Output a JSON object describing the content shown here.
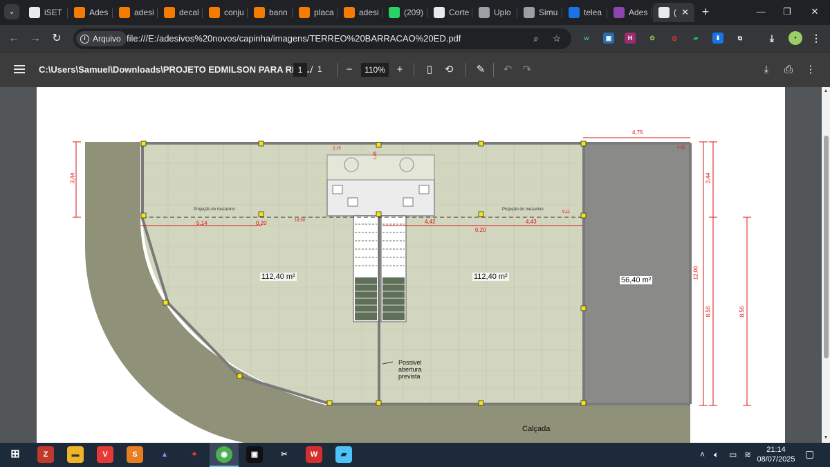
{
  "browser": {
    "tabs": [
      {
        "label": "iSET",
        "icon": "globe-icon",
        "color": "#e8eaed"
      },
      {
        "label": "Ades",
        "icon": "site-icon",
        "color": "#f57c00"
      },
      {
        "label": "adesi",
        "icon": "site-icon",
        "color": "#f57c00"
      },
      {
        "label": "decal",
        "icon": "site-icon",
        "color": "#f57c00"
      },
      {
        "label": "conju",
        "icon": "site-icon",
        "color": "#f57c00"
      },
      {
        "label": "bann",
        "icon": "site-icon",
        "color": "#f57c00"
      },
      {
        "label": "placa",
        "icon": "site-icon",
        "color": "#f57c00"
      },
      {
        "label": "adesi",
        "icon": "site-icon",
        "color": "#f57c00"
      },
      {
        "label": "(209)",
        "icon": "whatsapp-icon",
        "color": "#25d366"
      },
      {
        "label": "Corte",
        "icon": "chatgpt-icon",
        "color": "#e8eaed"
      },
      {
        "label": "Uplo",
        "icon": "globe-icon",
        "color": "#9aa0a6"
      },
      {
        "label": "Simu",
        "icon": "globe-icon",
        "color": "#9aa0a6"
      },
      {
        "label": "telea",
        "icon": "site-icon",
        "color": "#1a73e8"
      },
      {
        "label": "Ades",
        "icon": "site-icon",
        "color": "#8e44ad"
      },
      {
        "label": "(",
        "icon": "globe-icon",
        "color": "#e8eaed"
      }
    ],
    "omnibox": {
      "chip_label": "Arquivo",
      "url": "file:///E:/adesivos%20novos/capinha/imagens/TERREO%20BARRACAO%20ED.pdf"
    }
  },
  "pdf_viewer": {
    "title": "C:\\Users\\Samuel\\Downloads\\PROJETO EDMILSON PARA REN...",
    "page_current": "1",
    "page_separator": "/",
    "page_total": "1",
    "zoom": "110%"
  },
  "plan": {
    "areas": [
      "112,40 m²",
      "112,40 m²",
      "56,40 m²"
    ],
    "mezzanine_label": "Projeção do mezanino",
    "note_lines": [
      "Possivel",
      "abertura",
      "prevista"
    ],
    "sidewalk": "Calçada",
    "dimensions": {
      "d_475": "4,75",
      "d_344_left": "3,44",
      "d_344_right": "3,44",
      "d_514": "5,14",
      "d_020_a": "0,20",
      "d_1859": "18,59",
      "d_442": "4,42",
      "d_443": "4,43",
      "d_020_b": "0,20",
      "d_911": "9,11",
      "d_1200": "12,00",
      "d_856_a": "8,56",
      "d_856_b": "8,56",
      "d_215": "2,15",
      "d_145": "1,45",
      "d_485": "4,85"
    },
    "colors": {
      "floor": "#d3d6bf",
      "outer": "#8f9179",
      "garage": "#8a8a88",
      "dim": "#e01010"
    }
  },
  "taskbar": {
    "time": "21:14",
    "date": "08/07/2025"
  }
}
